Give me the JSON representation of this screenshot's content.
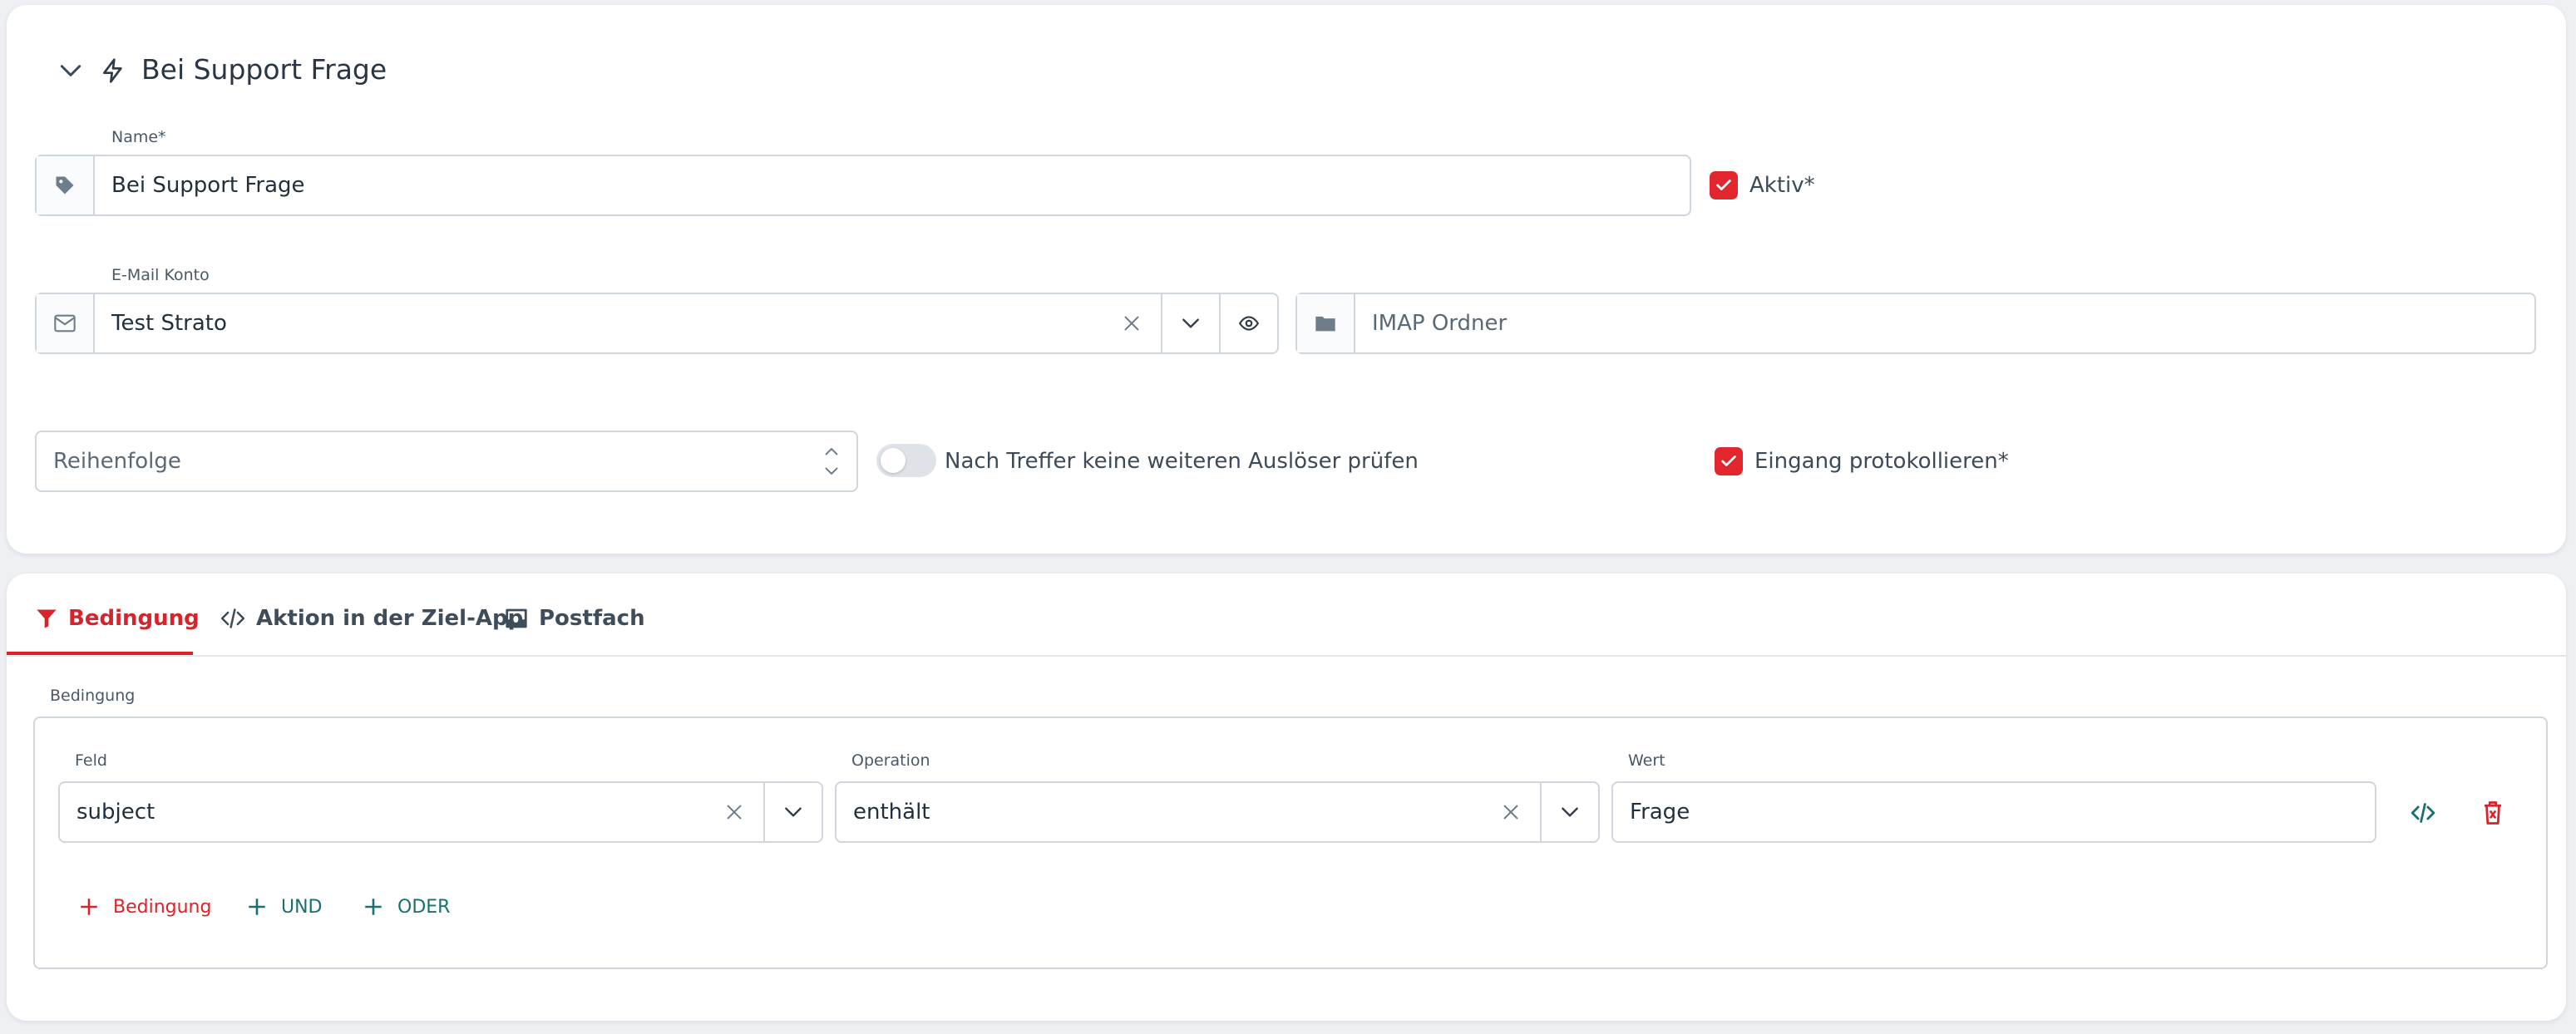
{
  "header": {
    "title": "Bei Support Frage"
  },
  "name_field": {
    "label": "Name*",
    "value": "Bei Support Frage"
  },
  "active": {
    "label": "Aktiv*",
    "checked": true
  },
  "email_account": {
    "label": "E-Mail Konto",
    "value": "Test Strato"
  },
  "imap_folder": {
    "placeholder": "IMAP Ordner"
  },
  "order": {
    "placeholder": "Reihenfolge"
  },
  "stop_toggle": {
    "label": "Nach Treffer keine weiteren Auslöser prüfen",
    "on": false
  },
  "log_incoming": {
    "label": "Eingang protokollieren*",
    "checked": true
  },
  "tabs": [
    {
      "label": "Bedingung",
      "icon": "filter-icon",
      "active": true
    },
    {
      "label": "Aktion in der Ziel-App",
      "icon": "code-icon",
      "active": false
    },
    {
      "label": "Postfach",
      "icon": "inbox-icon",
      "active": false
    }
  ],
  "condition": {
    "group_label": "Bedingung",
    "field_label": "Feld",
    "field_value": "subject",
    "operation_label": "Operation",
    "operation_value": "enthält",
    "value_label": "Wert",
    "value_value": "Frage",
    "add_condition": "Bedingung",
    "add_and": "UND",
    "add_or": "ODER"
  },
  "colors": {
    "accent_red": "#e1262d",
    "teal": "#1a6f6f",
    "border": "#cfd6de"
  }
}
